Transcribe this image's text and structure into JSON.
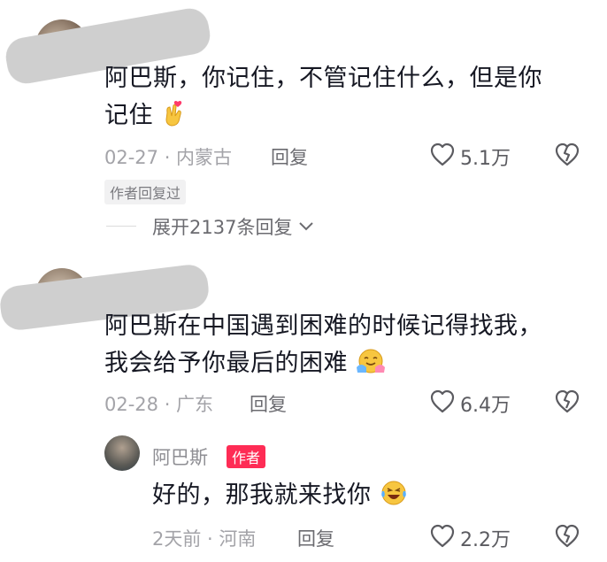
{
  "comments": [
    {
      "text_line1": "阿巴斯，你记住，不管记住什么，但是你",
      "text_line2": "记住",
      "meta": "02-27 · 内蒙古",
      "reply_label": "回复",
      "like_count": "5.1万",
      "badge": "作者回复过",
      "expand_label": "展开2137条回复",
      "emoji": "crossed-fingers-heart-emoji"
    },
    {
      "text_line1": "阿巴斯在中国遇到困难的时候记得找我，",
      "text_line2": "我会给予你最后的困难",
      "meta": "02-28 · 广东",
      "reply_label": "回复",
      "like_count": "6.4万",
      "emoji": "hug-emoji"
    }
  ],
  "author_reply": {
    "name": "阿巴斯",
    "tag": "作者",
    "text": "好的，那我就来找你",
    "meta": "2天前 · 河南",
    "reply_label": "回复",
    "like_count": "2.2万",
    "emoji": "laughing-tears-emoji"
  },
  "colors": {
    "accent": "#fe2c55",
    "text": "#161823",
    "meta": "#a3a3a8"
  }
}
